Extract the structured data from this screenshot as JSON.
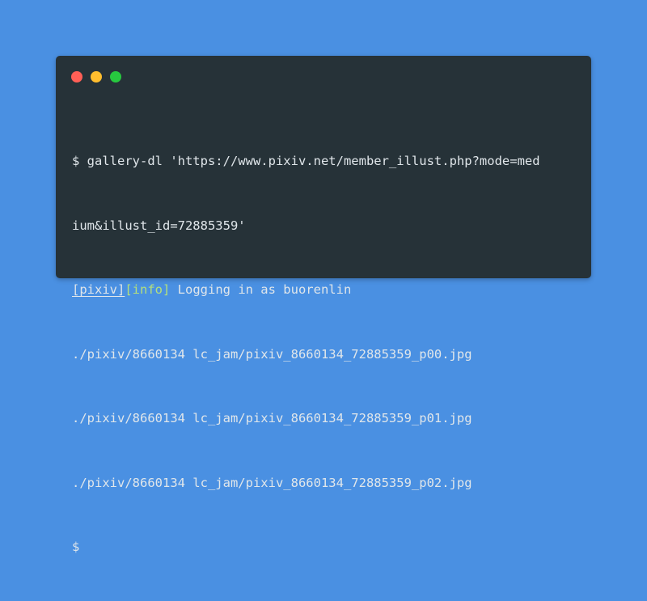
{
  "terminal": {
    "background": "#263238",
    "page_background": "#4a90e2",
    "window_controls": [
      {
        "name": "close-dot",
        "color": "#ff5f56"
      },
      {
        "name": "minimize-dot",
        "color": "#ffbd2e"
      },
      {
        "name": "maximize-dot",
        "color": "#27c93f"
      }
    ],
    "command_line_1": "$ gallery-dl 'https://www.pixiv.net/member_illust.php?mode=med",
    "command_line_2": "ium&illust_id=72885359'",
    "log": {
      "tag_pixiv": "[pixiv]",
      "tag_info": "[info]",
      "message": " Logging in as buorenlin"
    },
    "output_lines": [
      "./pixiv/8660134 lc_jam/pixiv_8660134_72885359_p00.jpg",
      "./pixiv/8660134 lc_jam/pixiv_8660134_72885359_p01.jpg",
      "./pixiv/8660134 lc_jam/pixiv_8660134_72885359_p02.jpg"
    ],
    "prompt": "$"
  }
}
